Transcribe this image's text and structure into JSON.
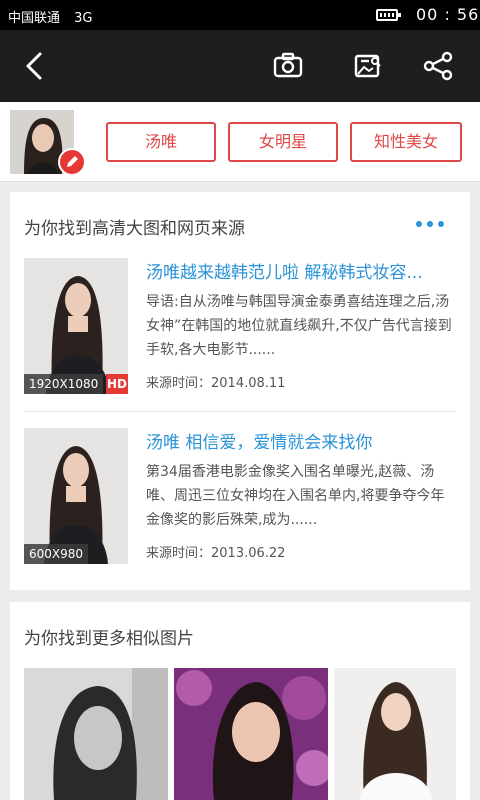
{
  "status_bar": {
    "carrier": "中国联通",
    "network": "3G",
    "time": "00 : 56"
  },
  "toolbar": {
    "back_icon": "back-arrow-icon",
    "camera_icon": "camera-icon",
    "gallery_icon": "image-search-icon",
    "share_icon": "share-icon"
  },
  "tags": [
    "汤唯",
    "女明星",
    "知性美女"
  ],
  "accent_color": "#e04848",
  "link_color": "#2b93d8",
  "source_section": {
    "title": "为你找到高清大图和网页来源",
    "results": [
      {
        "title": "汤唯越来越韩范儿啦 解秘韩式妆容...",
        "description": "导语:自从汤唯与韩国导演金泰勇喜结连理之后,汤女神”在韩国的地位就直线飙升,不仅广告代言接到手软,各大电影节......",
        "time": "来源时间：2014.08.11",
        "resolution": "1920X1080",
        "badge": "HD"
      },
      {
        "title": "汤唯 相信爱，爱情就会来找你",
        "description": "第34届香港电影金像奖入围名单曝光,赵薇、汤唯、周迅三位女神均在入围名单内,将要争夺今年金像奖的影后殊荣,成为......",
        "time": "来源时间：2013.06.22",
        "resolution": "600X980",
        "badge": ""
      }
    ]
  },
  "similar_section": {
    "title": "为你找到更多相似图片"
  }
}
